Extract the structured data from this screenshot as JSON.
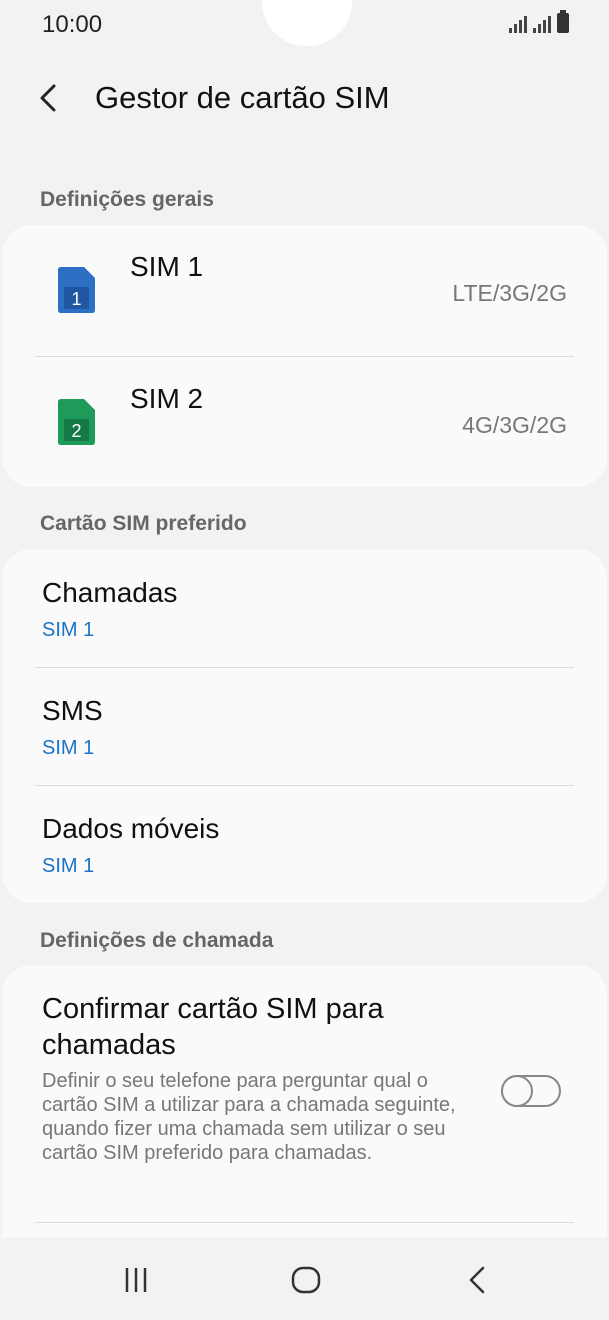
{
  "status_bar": {
    "time": "10:00"
  },
  "header": {
    "title": "Gestor de cartão SIM"
  },
  "sections": {
    "general": "Definições gerais",
    "preferred": "Cartão SIM preferido",
    "call": "Definições de chamada"
  },
  "sims": [
    {
      "name": "SIM 1",
      "badge": "1",
      "network": "LTE/3G/2G",
      "color": "#2d6fc3"
    },
    {
      "name": "SIM 2",
      "badge": "2",
      "network": "4G/3G/2G",
      "color": "#1e9a5a"
    }
  ],
  "preferred": [
    {
      "label": "Chamadas",
      "value": "SIM 1"
    },
    {
      "label": "SMS",
      "value": "SIM 1"
    },
    {
      "label": "Dados móveis",
      "value": "SIM 1"
    }
  ],
  "call_settings": {
    "confirm_title": "Confirmar cartão SIM para chamadas",
    "confirm_desc": "Definir o seu telefone para perguntar qual o cartão SIM a utilizar para a chamada seguinte, quando fizer uma chamada sem utilizar o seu cartão SIM preferido para chamadas.",
    "toggle_on": false
  },
  "colors": {
    "accent": "#1a73c6",
    "background": "#f2f2f2",
    "card": "#fafafa"
  }
}
